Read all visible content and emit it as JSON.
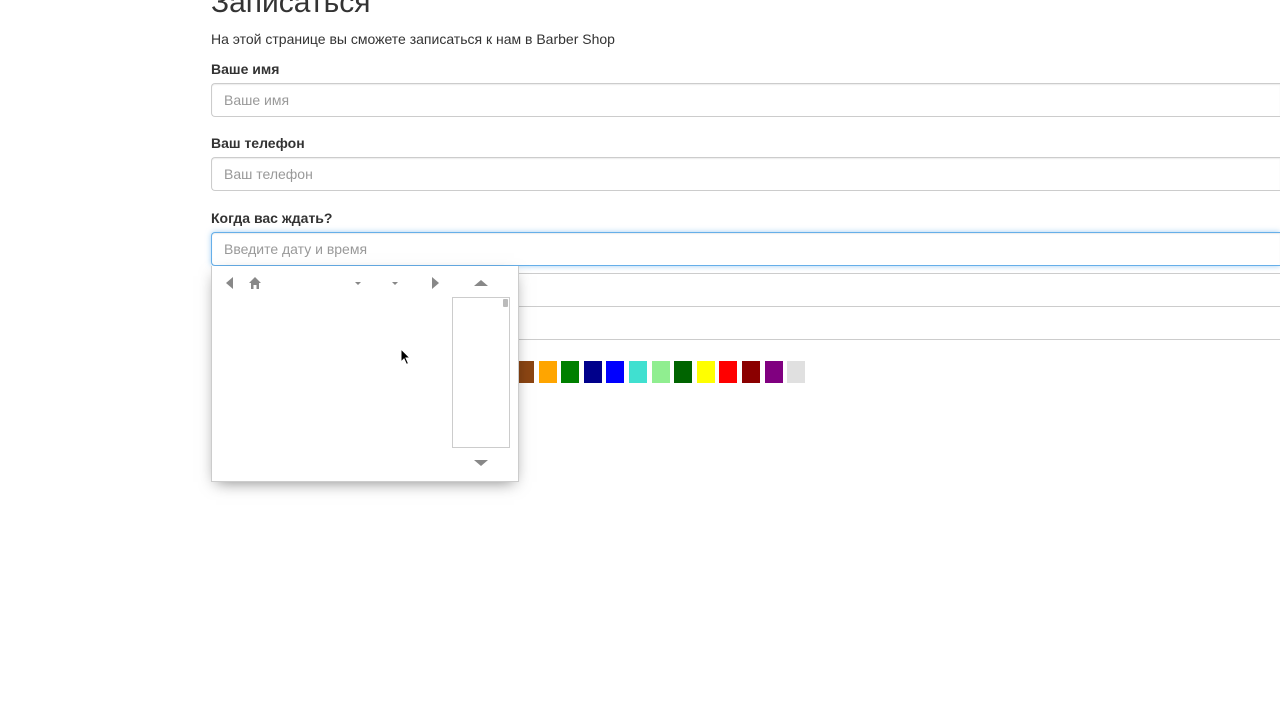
{
  "page": {
    "title": "Записаться",
    "lead": "На этой странице вы сможете записаться к нам в Barber Shop"
  },
  "form": {
    "name": {
      "label": "Ваше имя",
      "placeholder": "Ваше имя",
      "value": ""
    },
    "phone": {
      "label": "Ваш телефон",
      "placeholder": "Ваш телефон",
      "value": ""
    },
    "datetime": {
      "label": "Когда вас ждать?",
      "placeholder": "Введите дату и время",
      "value": ""
    }
  },
  "swatches": [
    "#8b4513",
    "#ffa500",
    "#008000",
    "#00008b",
    "#0000ff",
    "#40e0d0",
    "#90ee90",
    "#006400",
    "#ffff00",
    "#ff0000",
    "#8b0000",
    "#800080",
    "#e0e0e0"
  ],
  "picker": {
    "icons": {
      "prev": "chevron-left-icon",
      "home": "home-icon",
      "month": "chevron-down-icon",
      "year": "chevron-down-icon",
      "next": "chevron-right-icon",
      "time_up": "chevron-up-icon",
      "time_down": "chevron-down-icon"
    }
  }
}
